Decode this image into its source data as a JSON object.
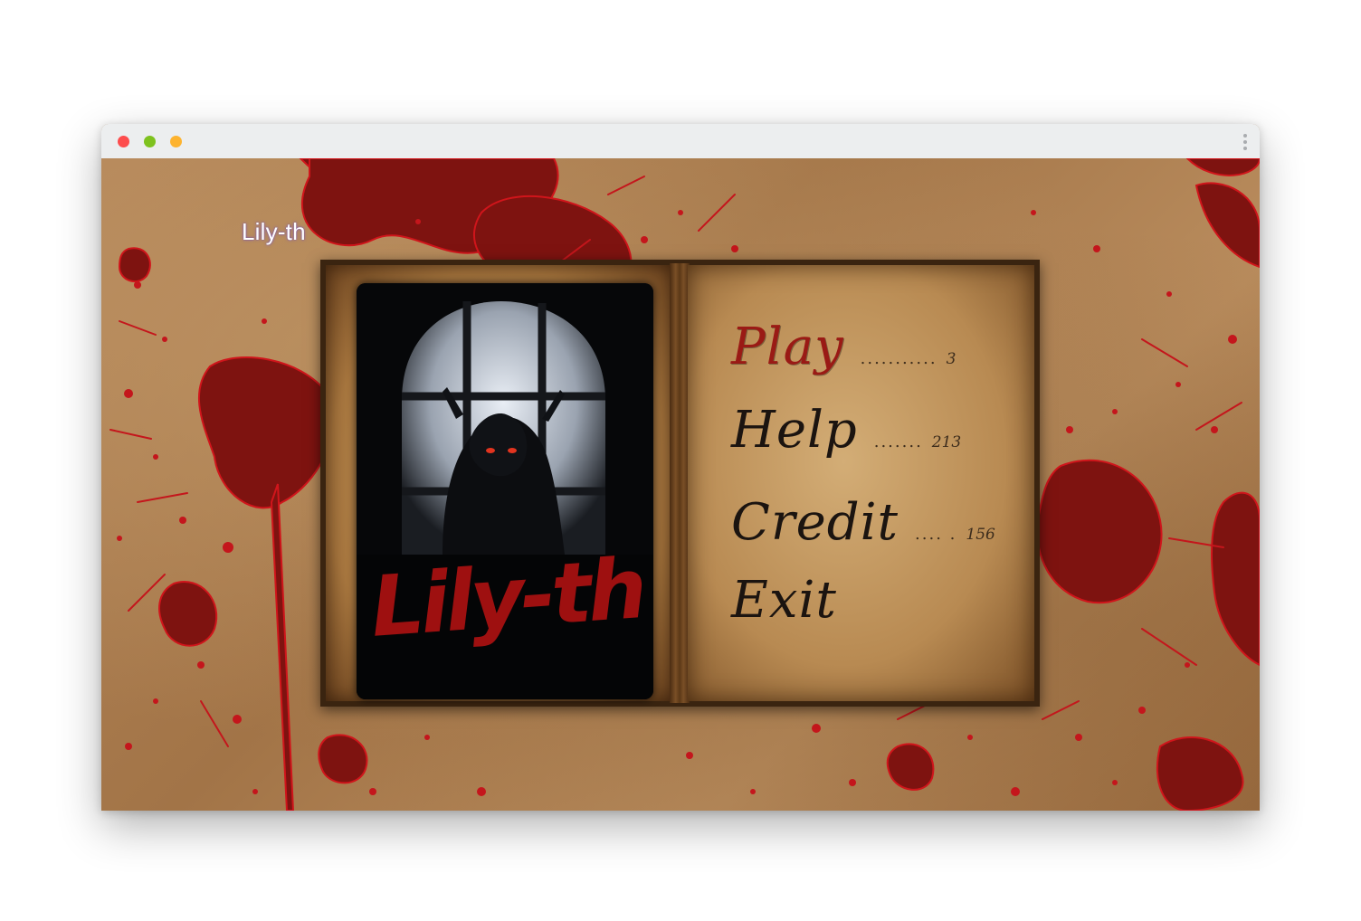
{
  "window": {
    "controls": [
      "close-dot",
      "minimize-dot",
      "maximize-dot"
    ]
  },
  "game": {
    "title": "Lily-th",
    "cover_logo": "Lily-th"
  },
  "menu": {
    "items": [
      {
        "label": "Play",
        "dots": "...........",
        "page": "3",
        "active": true
      },
      {
        "label": "Help",
        "dots": ".......",
        "page": "213",
        "active": false
      },
      {
        "label": "Credit",
        "dots": ".... .",
        "page": "156",
        "active": false
      },
      {
        "label": "Exit",
        "dots": "",
        "page": "",
        "active": false
      }
    ]
  },
  "colors": {
    "blood": "#8b1410",
    "blood_bright": "#c4161c",
    "parchment": "#c9a06a",
    "active_menu": "#9a1a15"
  }
}
